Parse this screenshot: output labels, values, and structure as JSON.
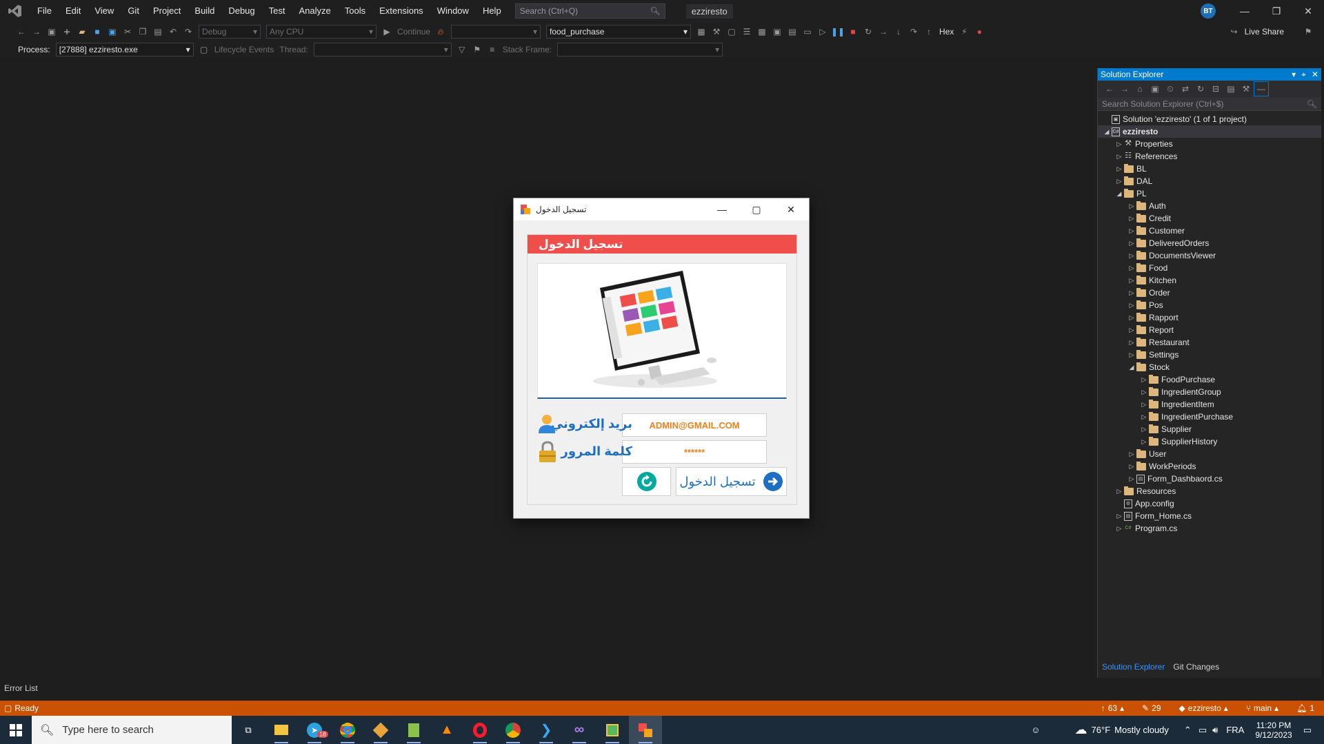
{
  "menubar": {
    "items": [
      "File",
      "Edit",
      "View",
      "Git",
      "Project",
      "Build",
      "Debug",
      "Test",
      "Analyze",
      "Tools",
      "Extensions",
      "Window",
      "Help"
    ],
    "search_placeholder": "Search (Ctrl+Q)",
    "solution_name": "ezziresto",
    "avatar_initials": "BT"
  },
  "toolbar": {
    "config": "Debug",
    "platform": "Any CPU",
    "continue_label": "Continue",
    "startup_item": "food_purchase",
    "hex_label": "Hex",
    "live_share_label": "Live Share"
  },
  "debug_toolbar": {
    "process_label": "Process:",
    "process_value": "[27888] ezziresto.exe",
    "lifecycle_label": "Lifecycle Events",
    "thread_label": "Thread:",
    "stack_frame_label": "Stack Frame:"
  },
  "solution_explorer": {
    "title": "Solution Explorer",
    "search_placeholder": "Search Solution Explorer (Ctrl+$)",
    "tabs": [
      "Solution Explorer",
      "Git Changes"
    ],
    "tree": [
      {
        "label": "Solution 'ezziresto' (1 of 1 project)",
        "depth": 0,
        "kind": "solution",
        "arrow": ""
      },
      {
        "label": "ezziresto",
        "depth": 0,
        "kind": "project",
        "arrow": "open",
        "selected": true
      },
      {
        "label": "Properties",
        "depth": 1,
        "kind": "wrench",
        "arrow": "closed"
      },
      {
        "label": "References",
        "depth": 1,
        "kind": "refs",
        "arrow": "closed"
      },
      {
        "label": "BL",
        "depth": 1,
        "kind": "folder",
        "arrow": "closed"
      },
      {
        "label": "DAL",
        "depth": 1,
        "kind": "folder",
        "arrow": "closed"
      },
      {
        "label": "PL",
        "depth": 1,
        "kind": "folder",
        "arrow": "open"
      },
      {
        "label": "Auth",
        "depth": 2,
        "kind": "folder",
        "arrow": "closed"
      },
      {
        "label": "Credit",
        "depth": 2,
        "kind": "folder",
        "arrow": "closed"
      },
      {
        "label": "Customer",
        "depth": 2,
        "kind": "folder",
        "arrow": "closed"
      },
      {
        "label": "DeliveredOrders",
        "depth": 2,
        "kind": "folder",
        "arrow": "closed"
      },
      {
        "label": "DocumentsViewer",
        "depth": 2,
        "kind": "folder",
        "arrow": "closed"
      },
      {
        "label": "Food",
        "depth": 2,
        "kind": "folder",
        "arrow": "closed"
      },
      {
        "label": "Kitchen",
        "depth": 2,
        "kind": "folder",
        "arrow": "closed"
      },
      {
        "label": "Order",
        "depth": 2,
        "kind": "folder",
        "arrow": "closed"
      },
      {
        "label": "Pos",
        "depth": 2,
        "kind": "folder",
        "arrow": "closed"
      },
      {
        "label": "Rapport",
        "depth": 2,
        "kind": "folder",
        "arrow": "closed"
      },
      {
        "label": "Report",
        "depth": 2,
        "kind": "folder",
        "arrow": "closed"
      },
      {
        "label": "Restaurant",
        "depth": 2,
        "kind": "folder",
        "arrow": "closed"
      },
      {
        "label": "Settings",
        "depth": 2,
        "kind": "folder",
        "arrow": "closed"
      },
      {
        "label": "Stock",
        "depth": 2,
        "kind": "folder",
        "arrow": "open"
      },
      {
        "label": "FoodPurchase",
        "depth": 3,
        "kind": "folder",
        "arrow": "closed"
      },
      {
        "label": "IngredientGroup",
        "depth": 3,
        "kind": "folder",
        "arrow": "closed"
      },
      {
        "label": "IngredientItem",
        "depth": 3,
        "kind": "folder",
        "arrow": "closed"
      },
      {
        "label": "IngredientPurchase",
        "depth": 3,
        "kind": "folder",
        "arrow": "closed"
      },
      {
        "label": "Supplier",
        "depth": 3,
        "kind": "folder",
        "arrow": "closed"
      },
      {
        "label": "SupplierHistory",
        "depth": 3,
        "kind": "folder",
        "arrow": "closed"
      },
      {
        "label": "User",
        "depth": 2,
        "kind": "folder",
        "arrow": "closed"
      },
      {
        "label": "WorkPeriods",
        "depth": 2,
        "kind": "folder",
        "arrow": "closed"
      },
      {
        "label": "Form_Dashbaord.cs",
        "depth": 2,
        "kind": "form",
        "arrow": "closed"
      },
      {
        "label": "Resources",
        "depth": 1,
        "kind": "folder",
        "arrow": "closed"
      },
      {
        "label": "App.config",
        "depth": 1,
        "kind": "config",
        "arrow": ""
      },
      {
        "label": "Form_Home.cs",
        "depth": 1,
        "kind": "form",
        "arrow": "closed"
      },
      {
        "label": "Program.cs",
        "depth": 1,
        "kind": "cs",
        "arrow": "closed"
      }
    ]
  },
  "error_list_label": "Error List",
  "statusbar": {
    "ready": "Ready",
    "up_count": "63",
    "edit_count": "29",
    "repo": "ezziresto",
    "branch": "main",
    "notifications": "1"
  },
  "dialog": {
    "title": "تسجيل الدخول",
    "header": "تسجيل الدخول",
    "email_label": "بريد إلكتروني",
    "email_value": "ADMIN@GMAIL.COM",
    "password_label": "كلمة المرور",
    "password_value": "******",
    "login_button": "تسجيل الدخول"
  },
  "taskbar": {
    "search_placeholder": "Type here to search",
    "telegram_badge": "18",
    "weather_temp": "76°F",
    "weather_desc": "Mostly cloudy",
    "language": "FRA",
    "time": "11:20 PM",
    "date": "9/12/2023"
  },
  "colors": {
    "accent": "#007acc",
    "statusbar": "#ca5100",
    "dialog_header": "#f04e4b",
    "label_blue": "#1e6fc4",
    "input_orange": "#f0801a"
  }
}
